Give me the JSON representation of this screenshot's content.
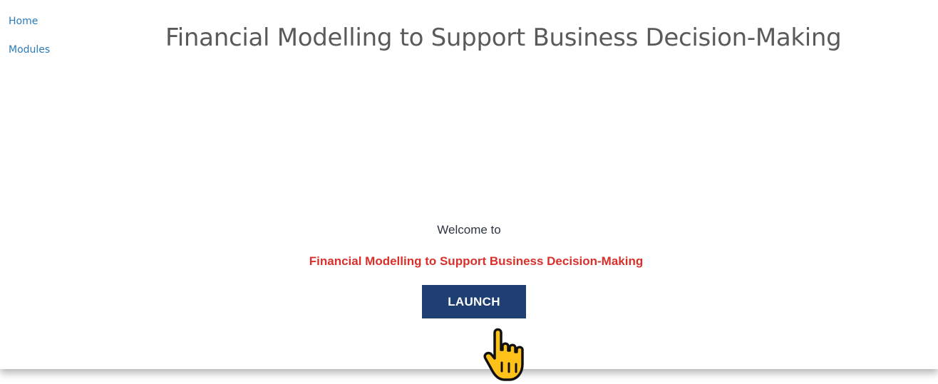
{
  "nav": {
    "items": [
      {
        "label": "Home"
      },
      {
        "label": "Modules"
      }
    ]
  },
  "header": {
    "title": "Financial Modelling to Support Business Decision-Making"
  },
  "main": {
    "welcome": "Welcome to",
    "course_name": "Financial Modelling to Support Business Decision-Making",
    "launch_label": "LAUNCH"
  },
  "icons": {
    "pointer": "hand-pointer-icon"
  },
  "colors": {
    "link": "#2b7bb9",
    "title": "#5a5a5a",
    "accent_red": "#d9302c",
    "button_bg": "#1f3f73",
    "hand": "#ffc21a"
  }
}
